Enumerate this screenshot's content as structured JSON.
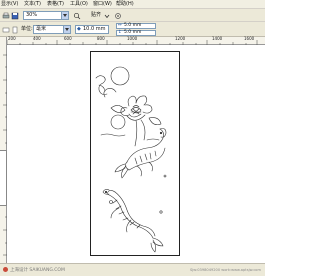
{
  "menu": {
    "items": [
      {
        "label": "显示(V)"
      },
      {
        "label": "文本(T)"
      },
      {
        "label": "表格(T)"
      },
      {
        "label": "工具(O)"
      },
      {
        "label": "窗口(W)"
      },
      {
        "label": "帮助(H)"
      }
    ]
  },
  "toolbar": {
    "zoom_value": "30%",
    "snap_label": "贴齐",
    "icons": [
      "new-icon",
      "open-icon",
      "save-icon",
      "print-icon",
      "cut-icon"
    ]
  },
  "property_bar": {
    "units_label": "单位:",
    "units_value": "毫米",
    "nudge_value": "10.0 mm",
    "dup_x": "5.0 mm",
    "dup_y": "5.0 mm"
  },
  "ruler": {
    "ticks": [
      "200",
      "400",
      "600",
      "800",
      "1000",
      "1200",
      "1400",
      "1600"
    ]
  },
  "artwork": {
    "subject": "carp-lotus-moon-line-drawing"
  },
  "watermark": {
    "left_text": "上海设计 SAIKUANG.COM",
    "right_text": "Sjw:0398049200 work:www.aptsjw.com"
  },
  "colors": {
    "chrome": "#ece9d8",
    "menubar": "#f1efe2",
    "input_border": "#7f9db9"
  }
}
